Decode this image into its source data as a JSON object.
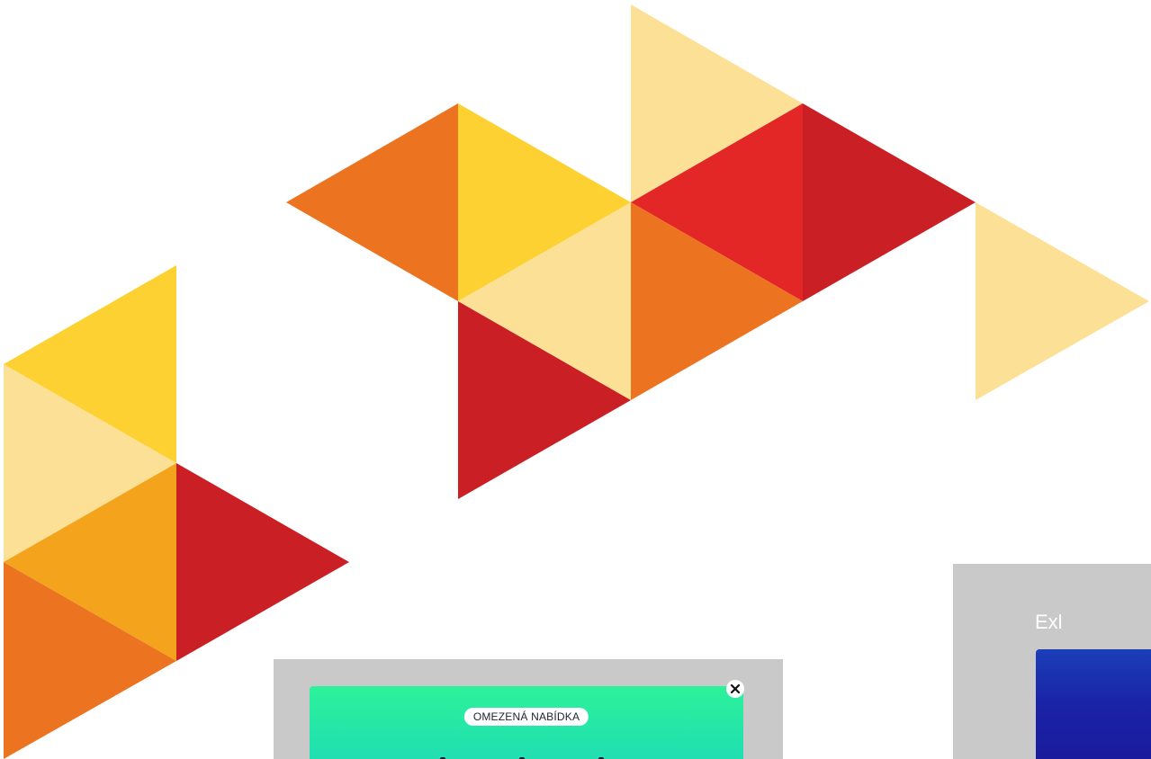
{
  "promo": {
    "badge_label": "OMEZENÁ NABÍDKA",
    "close_icon": "close-icon"
  },
  "explore_card": {
    "title_fragment": "Exl"
  },
  "colors": {
    "orange": "#ec7421",
    "yellow": "#fdd132",
    "pale_yellow": "#fbe095",
    "red_bright": "#e32626",
    "red_dark": "#c91f25",
    "amber": "#f4a41c",
    "promo_green": "#22e2ad",
    "panel_gray": "#c9c9c9",
    "card_blue": "#1a22a6"
  }
}
